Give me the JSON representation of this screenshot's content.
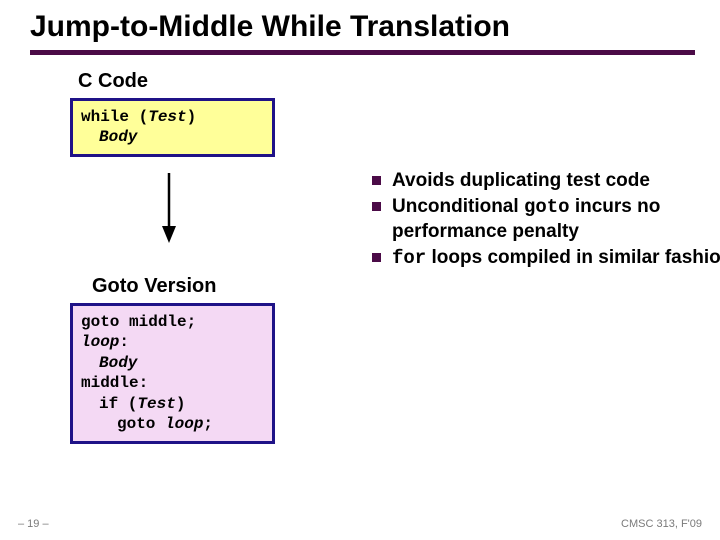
{
  "title": "Jump-to-Middle While Translation",
  "sections": {
    "ccode": "C Code",
    "goto": "Goto Version"
  },
  "code1": {
    "l1a": "while (",
    "l1b": "Test",
    "l1c": ")",
    "l2": "Body"
  },
  "code2": {
    "l1": "goto middle;",
    "l2a": "loop",
    "l2b": ":",
    "l3": "Body",
    "l4": "middle:",
    "l5a": "if (",
    "l5b": "Test",
    "l5c": ")",
    "l6a": "goto ",
    "l6b": "loop",
    "l6c": ";"
  },
  "bullets": {
    "b1": "Avoids duplicating test code",
    "b2a": "Unconditional ",
    "b2b": "goto",
    "b2c": " incurs no performance penalty",
    "b3a": " ",
    "b3b": "for",
    "b3c": " loops compiled in similar fashion"
  },
  "footer": {
    "left": "– 19 –",
    "right": "CMSC 313, F'09"
  }
}
